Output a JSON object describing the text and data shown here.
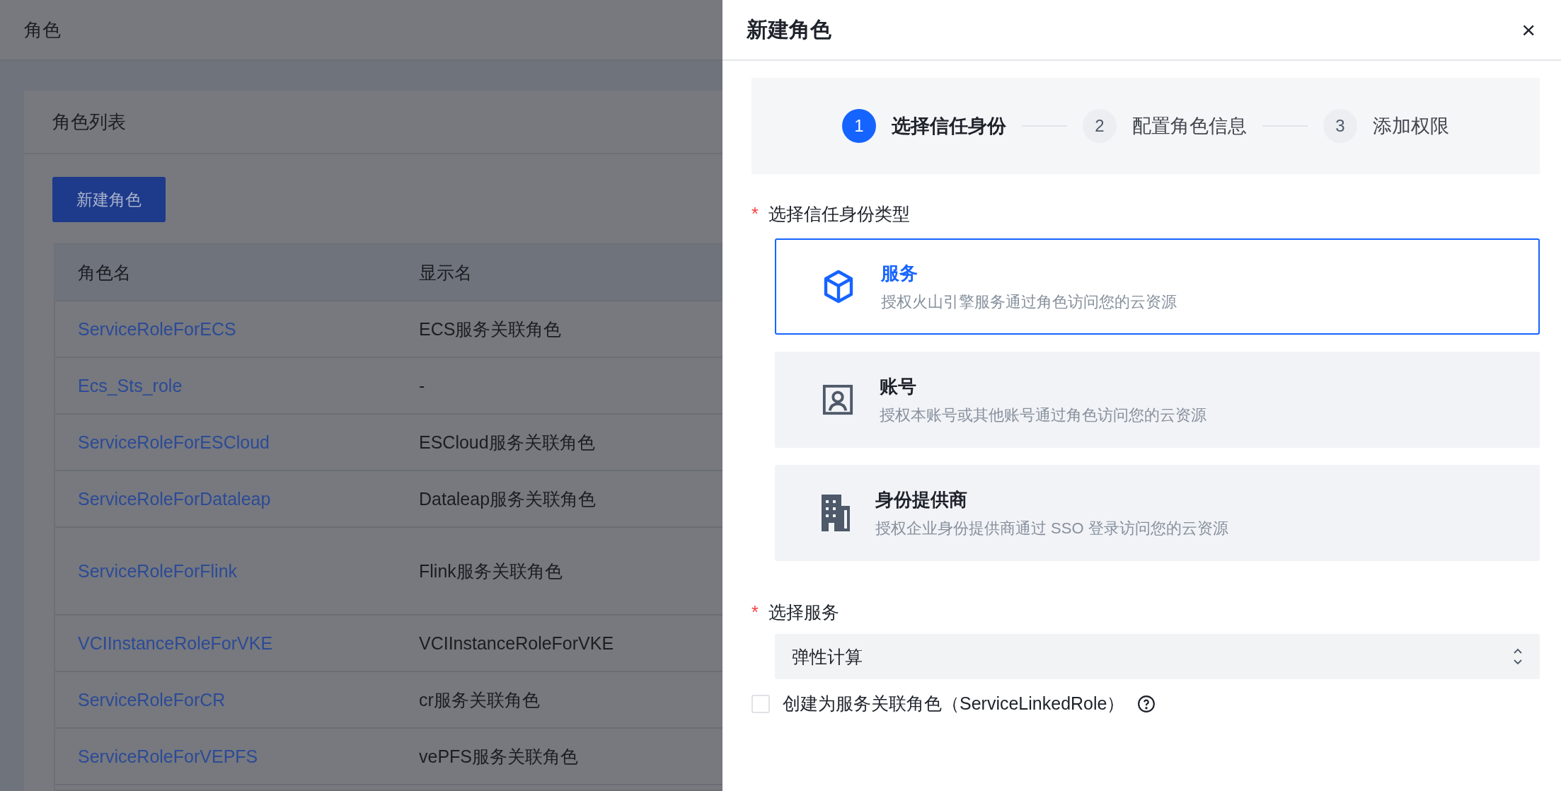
{
  "page": {
    "title": "角色"
  },
  "card": {
    "title": "角色列表",
    "create_button": "新建角色"
  },
  "table": {
    "columns": [
      "角色名",
      "显示名"
    ],
    "rows": [
      {
        "name": "ServiceRoleForECS",
        "display": "ECS服务关联角色",
        "tall": false
      },
      {
        "name": "Ecs_Sts_role",
        "display": "-",
        "tall": false
      },
      {
        "name": "ServiceRoleForESCloud",
        "display": "ESCloud服务关联角色",
        "tall": false
      },
      {
        "name": "ServiceRoleForDataleap",
        "display": "Dataleap服务关联角色",
        "tall": false
      },
      {
        "name": "ServiceRoleForFlink",
        "display": "Flink服务关联角色",
        "tall": true
      },
      {
        "name": "VCIInstanceRoleForVKE",
        "display": "VCIInstanceRoleForVKE",
        "tall": false
      },
      {
        "name": "ServiceRoleForCR",
        "display": "cr服务关联角色",
        "tall": false
      },
      {
        "name": "ServiceRoleForVEPFS",
        "display": "vePFS服务关联角色",
        "tall": false
      }
    ]
  },
  "drawer": {
    "title": "新建角色",
    "close": "×",
    "steps": [
      {
        "number": "1",
        "label": "选择信任身份",
        "selected": true
      },
      {
        "number": "2",
        "label": "配置角色信息",
        "selected": false
      },
      {
        "number": "3",
        "label": "添加权限",
        "selected": false
      }
    ],
    "trust_type": {
      "label": "选择信任身份类型",
      "required_mark": "*",
      "options": [
        {
          "title": "服务",
          "description": "授权火山引擎服务通过角色访问您的云资源",
          "selected": true
        },
        {
          "title": "账号",
          "description": "授权本账号或其他账号通过角色访问您的云资源",
          "selected": false
        },
        {
          "title": "身份提供商",
          "description": "授权企业身份提供商通过 SSO 登录访问您的云资源",
          "selected": false
        }
      ]
    },
    "service": {
      "label": "选择服务",
      "required_mark": "*",
      "value": "弹性计算"
    },
    "linked_role": {
      "label": "创建为服务关联角色（ServiceLinkedRole）",
      "checked": false
    }
  }
}
